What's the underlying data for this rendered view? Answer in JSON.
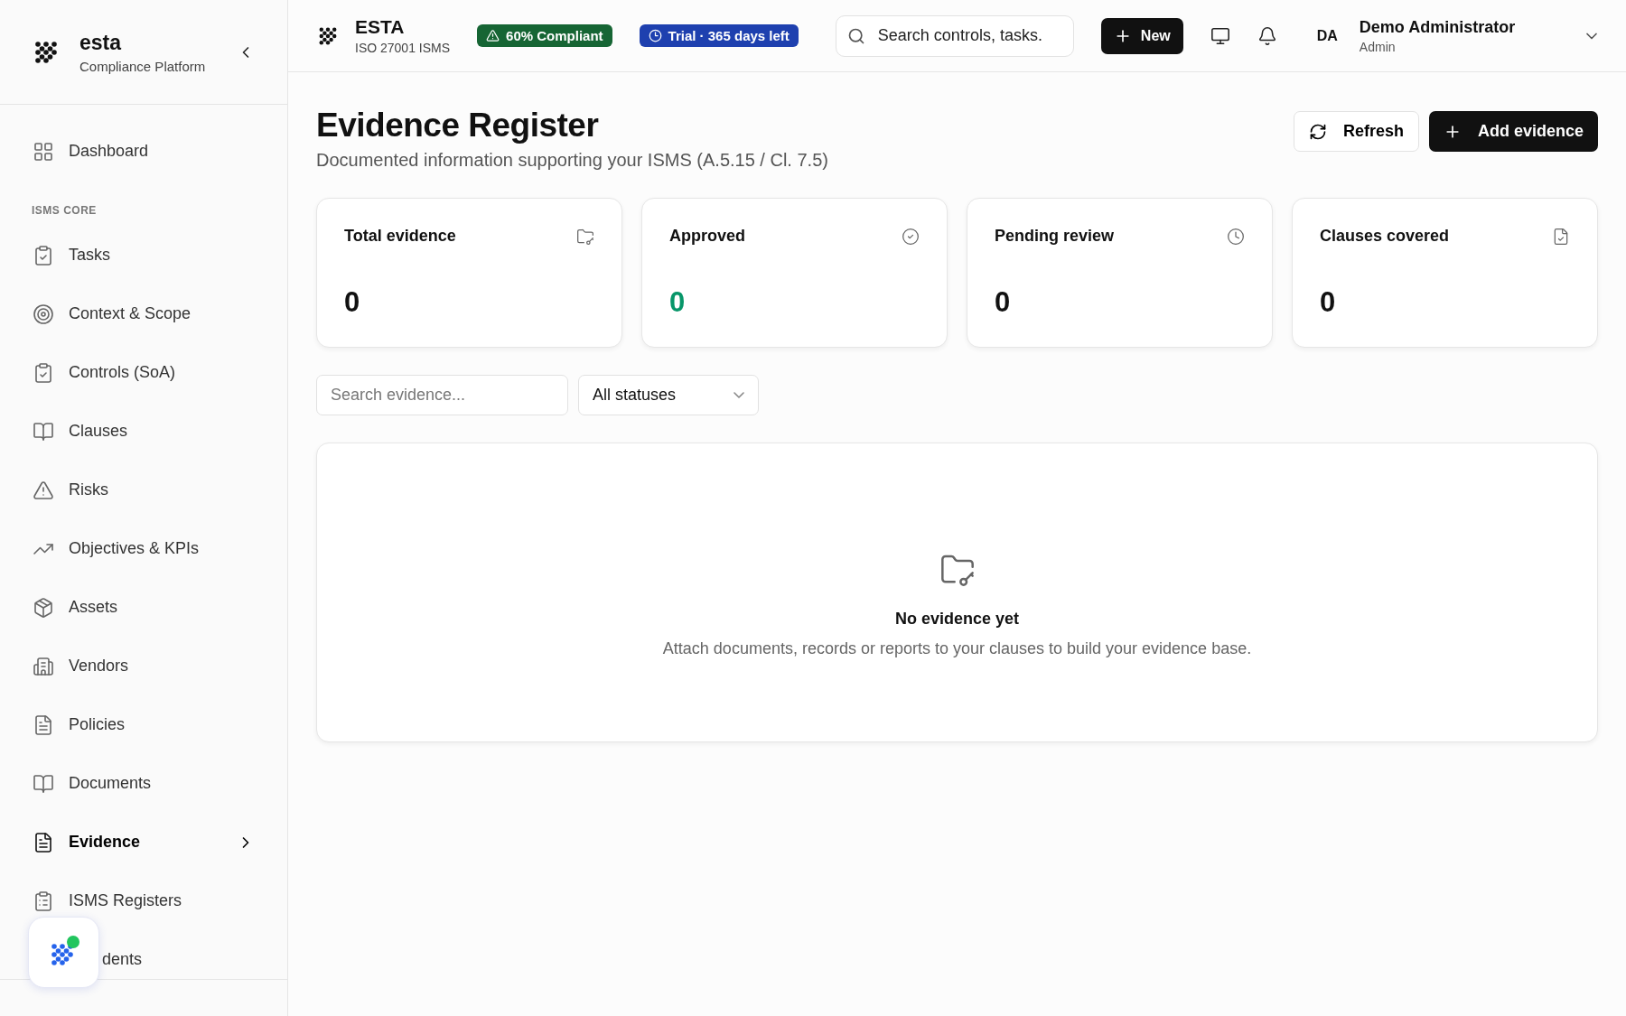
{
  "sidebar": {
    "brand": {
      "name": "esta",
      "subtitle": "Compliance Platform"
    },
    "top_items": [
      {
        "label": "Dashboard",
        "selected": false,
        "expandable": false
      }
    ],
    "section_title": "ISMS CORE",
    "items": [
      {
        "label": "Tasks",
        "selected": false,
        "expandable": false
      },
      {
        "label": "Context & Scope",
        "selected": false,
        "expandable": false
      },
      {
        "label": "Controls (SoA)",
        "selected": false,
        "expandable": false
      },
      {
        "label": "Clauses",
        "selected": false,
        "expandable": false
      },
      {
        "label": "Risks",
        "selected": false,
        "expandable": false
      },
      {
        "label": "Objectives & KPIs",
        "selected": false,
        "expandable": false
      },
      {
        "label": "Assets",
        "selected": false,
        "expandable": false
      },
      {
        "label": "Vendors",
        "selected": false,
        "expandable": false
      },
      {
        "label": "Policies",
        "selected": false,
        "expandable": false
      },
      {
        "label": "Documents",
        "selected": false,
        "expandable": false
      },
      {
        "label": "Evidence",
        "selected": true,
        "expandable": true
      },
      {
        "label": "ISMS Registers",
        "selected": false,
        "expandable": false
      },
      {
        "label": "dents",
        "selected": false,
        "expandable": false,
        "covered": true
      }
    ]
  },
  "header": {
    "org": "ESTA",
    "org_subtitle": "ISO 27001 ISMS",
    "compliance_badge": "60% Compliant",
    "trial_badge": "Trial · 365 days left",
    "search": {
      "placeholder": "Search controls, tasks."
    },
    "new_button": "New",
    "user": {
      "initials": "DA",
      "name": "Demo Administrator",
      "role": "Admin"
    }
  },
  "page": {
    "title": "Evidence Register",
    "subtitle": "Documented information supporting your ISMS (A.5.15 / Cl. 7.5)",
    "refresh_button": "Refresh",
    "add_button": "Add evidence"
  },
  "stats": [
    {
      "label": "Total evidence",
      "value": "0",
      "color": "#111111"
    },
    {
      "label": "Approved",
      "value": "0",
      "color": "#079669"
    },
    {
      "label": "Pending review",
      "value": "0",
      "color": "#111111"
    },
    {
      "label": "Clauses covered",
      "value": "0",
      "color": "#111111"
    }
  ],
  "filters": {
    "search": {
      "placeholder": "Search evidence..."
    },
    "status": {
      "value": "All statuses"
    }
  },
  "empty_state": {
    "title": "No evidence yet",
    "message": "Attach documents, records or reports to your clauses to build your evidence base."
  }
}
